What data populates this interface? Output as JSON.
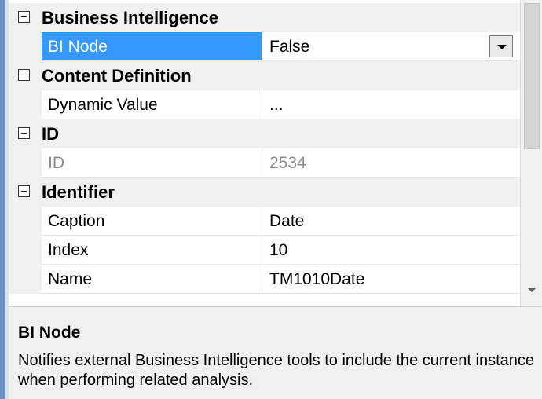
{
  "property_grid": {
    "categories": [
      {
        "label": "Business Intelligence",
        "properties": [
          {
            "name": "BI Node",
            "value": "False",
            "selected": true,
            "dropdown": true
          }
        ]
      },
      {
        "label": "Content Definition",
        "properties": [
          {
            "name": "Dynamic Value",
            "value": "..."
          }
        ]
      },
      {
        "label": "ID",
        "properties": [
          {
            "name": "ID",
            "value": "2534",
            "disabled": true
          }
        ]
      },
      {
        "label": "Identifier",
        "properties": [
          {
            "name": "Caption",
            "value": "Date"
          },
          {
            "name": "Index",
            "value": "10"
          },
          {
            "name": "Name",
            "value": "TM1010Date"
          }
        ]
      }
    ]
  },
  "description": {
    "title": "BI Node",
    "text": "Notifies external Business Intelligence tools to include the current instance when performing related analysis."
  },
  "colors": {
    "selection": "#3399ff",
    "category_background": "#f0f0f0",
    "disabled_text": "#8a8a8a",
    "window_border": "#6b8ec4"
  }
}
